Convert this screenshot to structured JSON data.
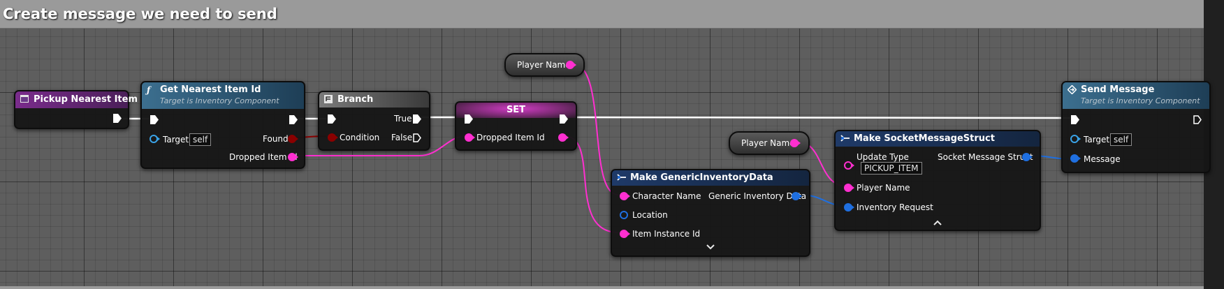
{
  "comment": {
    "title": "Create message we need to send"
  },
  "nodes": {
    "pickup": {
      "title": "Pickup Nearest Item"
    },
    "get_nearest": {
      "title": "Get Nearest Item Id",
      "subtitle": "Target is Inventory Component",
      "target_label": "Target",
      "target_value": "self",
      "found_label": "Found",
      "dropped_label": "Dropped Item Id"
    },
    "branch": {
      "title": "Branch",
      "condition_label": "Condition",
      "true_label": "True",
      "false_label": "False"
    },
    "set": {
      "title": "SET",
      "dropped_label": "Dropped Item Id"
    },
    "player_name_top": {
      "label": "Player Name"
    },
    "player_name_mid": {
      "label": "Player Name"
    },
    "make_generic": {
      "title": "Make GenericInventoryData",
      "character_label": "Character Name",
      "location_label": "Location",
      "item_instance_label": "Item Instance Id",
      "output_label": "Generic Inventory Data"
    },
    "make_socket": {
      "title": "Make SocketMessageStruct",
      "update_type_label": "Update Type",
      "update_type_value": "PICKUP_ITEM",
      "player_name_label": "Player Name",
      "inventory_request_label": "Inventory Request",
      "output_label": "Socket Message Struct"
    },
    "send": {
      "title": "Send Message",
      "subtitle": "Target is Inventory Component",
      "target_label": "Target",
      "target_value": "self",
      "message_label": "Message"
    }
  },
  "colors": {
    "exec": "#ffffff",
    "name_pin": "#ff2fd0",
    "bool_pin": "#8a0000",
    "struct_pin": "#1f6fe0",
    "object_pin": "#3aa3e8",
    "event_header": "#7a2c8c",
    "function_header": "#3c6f8f",
    "struct_header": "#1f3a68",
    "set_header": "#b02fa6"
  },
  "icons": {
    "event": "event-icon",
    "function": "function-icon",
    "branch": "branch-icon",
    "make_struct": "make-struct-icon",
    "send": "send-message-icon",
    "expand": "chevron-down-icon",
    "collapse": "chevron-up-icon"
  }
}
